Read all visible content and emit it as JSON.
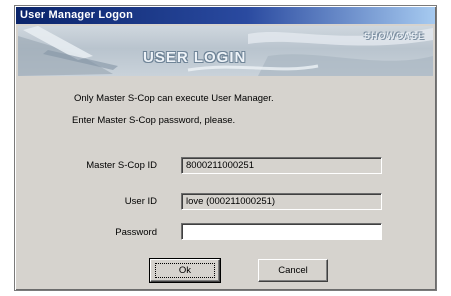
{
  "window": {
    "title": "User Manager Logon"
  },
  "banner": {
    "title": "USER LOGIN",
    "brand": "SHOWCASE"
  },
  "messages": {
    "line1": "Only Master S-Cop can execute User Manager.",
    "line2": "Enter Master S-Cop password, please."
  },
  "form": {
    "master_label": "Master S-Cop ID",
    "master_value": "8000211000251",
    "user_label": "User ID",
    "user_value": "love (000211000251)",
    "password_label": "Password",
    "password_value": ""
  },
  "buttons": {
    "ok": "Ok",
    "cancel": "Cancel"
  }
}
